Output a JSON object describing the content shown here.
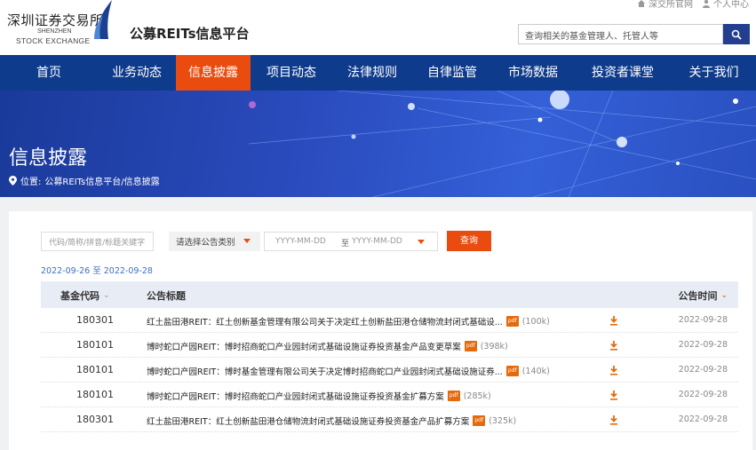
{
  "header": {
    "logo_cn": "深圳证券交易所",
    "logo_en_line1": "SHENZHEN",
    "logo_en_line2": "STOCK EXCHANGE",
    "platform_title": "公募REITs信息平台",
    "top_links": [
      {
        "label": "深交所官网",
        "icon": "home-icon"
      },
      {
        "label": "个人中心",
        "icon": "user-icon"
      }
    ],
    "search_placeholder": "查询相关的基金管理人、托管人等",
    "brand_color": "#0f3b8c",
    "accent_color": "#e94c0e"
  },
  "nav": {
    "items": [
      {
        "label": "首页",
        "active": false
      },
      {
        "label": "业务动态",
        "active": false
      },
      {
        "label": "信息披露",
        "active": true
      },
      {
        "label": "项目动态",
        "active": false
      },
      {
        "label": "法律规则",
        "active": false
      },
      {
        "label": "自律监管",
        "active": false
      },
      {
        "label": "市场数据",
        "active": false
      },
      {
        "label": "投资者课堂",
        "active": false
      },
      {
        "label": "关于我们",
        "active": false
      }
    ]
  },
  "banner": {
    "title": "信息披露",
    "breadcrumb_prefix": "位置:",
    "breadcrumb_path": "公募REITs信息平台/信息披露"
  },
  "filters": {
    "code_placeholder": "代码/简称/拼音/标题关键字",
    "type_label": "请选择公告类别",
    "date_from_placeholder": "YYYY-MM-DD",
    "date_separator": "至",
    "date_to_placeholder": "YYYY-MM-DD",
    "query_label": "查询",
    "date_range": "2022-09-26 至 2022-09-28"
  },
  "table": {
    "headers": {
      "code": "基金代码",
      "title": "公告标题",
      "time": "公告时间"
    },
    "rows": [
      {
        "code": "180301",
        "title": "红土盐田港REIT：红土创新基金管理有限公司关于决定红土创新盐田港仓储物流封闭式基础设...",
        "size": "(100k)",
        "time": "2022-09-28"
      },
      {
        "code": "180101",
        "title": "博时蛇口产园REIT：博时招商蛇口产业园封闭式基础设施证券投资基金产品变更草案",
        "size": "(398k)",
        "time": "2022-09-28"
      },
      {
        "code": "180101",
        "title": "博时蛇口产园REIT：博时基金管理有限公司关于决定博时招商蛇口产业园封闭式基础设施证券...",
        "size": "(140k)",
        "time": "2022-09-28"
      },
      {
        "code": "180101",
        "title": "博时蛇口产园REIT：博时招商蛇口产业园封闭式基础设施证券投资基金扩募方案",
        "size": "(285k)",
        "time": "2022-09-28"
      },
      {
        "code": "180301",
        "title": "红土盐田港REIT：红土创新盐田港仓储物流封闭式基础设施证券投资基金产品扩募方案",
        "size": "(325k)",
        "time": "2022-09-28"
      }
    ]
  }
}
